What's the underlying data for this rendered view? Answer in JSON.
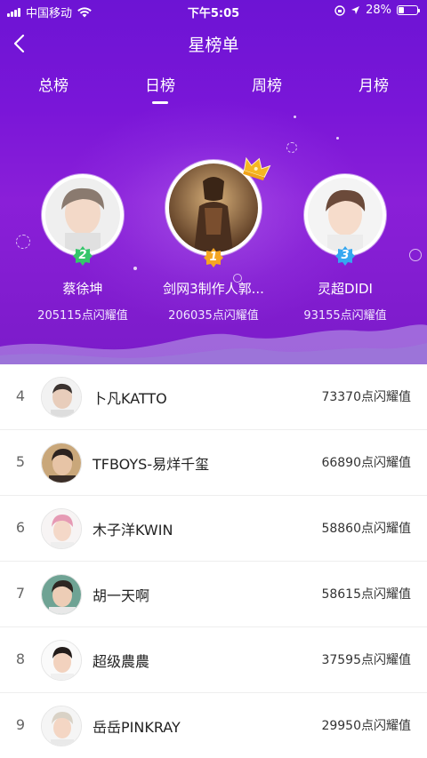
{
  "status_bar": {
    "carrier": "中国移动",
    "time": "下午5:05",
    "battery": "28%",
    "battery_level": 0.28
  },
  "nav": {
    "back_icon": "chevron-left-icon",
    "title": "星榜单"
  },
  "tabs": [
    {
      "label": "总榜",
      "active": false
    },
    {
      "label": "日榜",
      "active": true
    },
    {
      "label": "周榜",
      "active": false
    },
    {
      "label": "月榜",
      "active": false
    }
  ],
  "podium": [
    {
      "rank": "2",
      "name": "蔡徐坤",
      "score": "205115点闪耀值",
      "badge_color": "#35c66b"
    },
    {
      "rank": "1",
      "name": "剑网3制作人郭...",
      "score": "206035点闪耀值",
      "badge_color": "#f5a623"
    },
    {
      "rank": "3",
      "name": "灵超DIDI",
      "score": "93155点闪耀值",
      "badge_color": "#35a7f0"
    }
  ],
  "list": [
    {
      "rank": "4",
      "name": "卜凡KATTO",
      "score": "73370点闪耀值"
    },
    {
      "rank": "5",
      "name": "TFBOYS-易烊千玺",
      "score": "66890点闪耀值"
    },
    {
      "rank": "6",
      "name": "木子洋KWIN",
      "score": "58860点闪耀值"
    },
    {
      "rank": "7",
      "name": "胡一天啊",
      "score": "58615点闪耀值"
    },
    {
      "rank": "8",
      "name": "超级農農",
      "score": "37595点闪耀值"
    },
    {
      "rank": "9",
      "name": "岳岳PINKRAY",
      "score": "29950点闪耀值"
    }
  ],
  "colors": {
    "hero_purple": "#7a16d8",
    "crown_gold": "#f5b623"
  }
}
